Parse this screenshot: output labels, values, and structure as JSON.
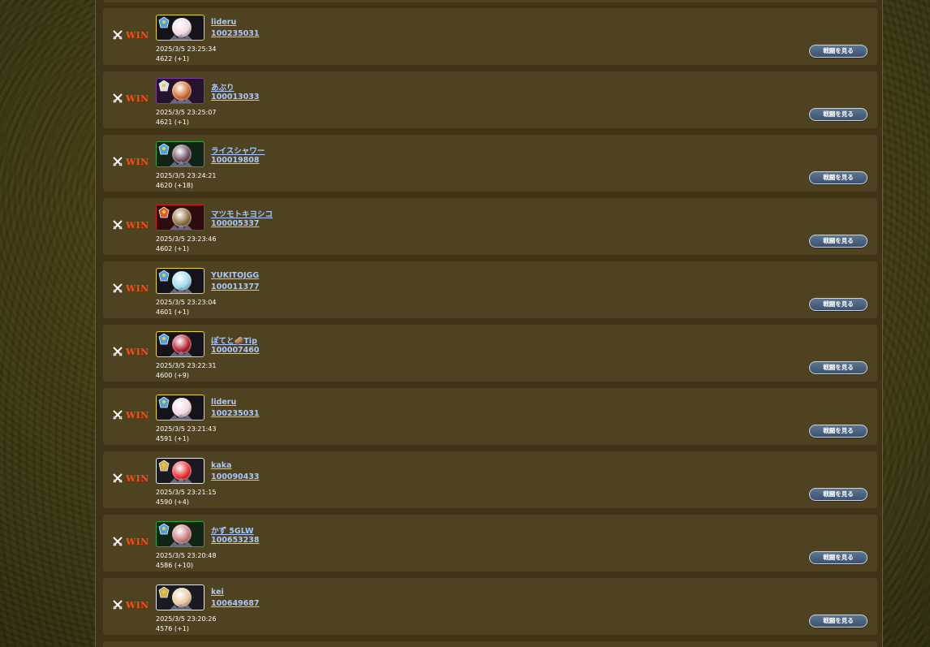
{
  "colors": {
    "win": "#ff4a12",
    "link": "#a8c8ff",
    "card": "#4e4220",
    "panel": "#403416",
    "button": "#4a6282"
  },
  "battles": [
    {
      "result": "WIN",
      "name": "lideru",
      "id": "100235031",
      "datetime": "2025/3/5 23:25:34",
      "rate": "4622 (+1)",
      "button": "戦闘を見る",
      "frame": "yellow",
      "avatar_color": "#f0d8e0",
      "badge": "blue-knight-icon"
    },
    {
      "result": "WIN",
      "name": "あぶり",
      "id": "100013033",
      "datetime": "2025/3/5 23:25:07",
      "rate": "4621 (+1)",
      "button": "戦闘を見る",
      "frame": "purple",
      "avatar_color": "#d06a2a",
      "badge": "skull-icon"
    },
    {
      "result": "WIN",
      "name": "ライスシャワー",
      "id": "100019808",
      "datetime": "2025/3/5 23:24:21",
      "rate": "4620 (+18)",
      "button": "戦闘を見る",
      "frame": "green",
      "avatar_color": "#6a4a5a",
      "badge": "blue-knight-icon"
    },
    {
      "result": "WIN",
      "name": "マツモトキヨシコ",
      "id": "100005337",
      "datetime": "2025/3/5 23:23:46",
      "rate": "4602 (+1)",
      "button": "戦闘を見る",
      "frame": "red",
      "avatar_color": "#8a6a3a",
      "badge": "dragon-icon"
    },
    {
      "result": "WIN",
      "name": "YUKITOJGG",
      "id": "100011377",
      "datetime": "2025/3/5 23:23:04",
      "rate": "4601 (+1)",
      "button": "戦闘を見る",
      "frame": "yellow",
      "avatar_color": "#9ad8ec",
      "badge": "blue-knight-icon"
    },
    {
      "result": "WIN",
      "name": "ぽてと🥔Tip",
      "id": "100007460",
      "datetime": "2025/3/5 23:22:31",
      "rate": "4600 (+9)",
      "button": "戦闘を見る",
      "frame": "yellow",
      "avatar_color": "#b01c2a",
      "badge": "blue-knight-icon"
    },
    {
      "result": "WIN",
      "name": "lideru",
      "id": "100235031",
      "datetime": "2025/3/5 23:21:43",
      "rate": "4591 (+1)",
      "button": "戦闘を見る",
      "frame": "yellow",
      "avatar_color": "#f0d8e0",
      "badge": "blue-knight-icon"
    },
    {
      "result": "WIN",
      "name": "kaka",
      "id": "100090433",
      "datetime": "2025/3/5 23:21:15",
      "rate": "4590 (+4)",
      "button": "戦闘を見る",
      "frame": "white",
      "avatar_color": "#e82a2a",
      "badge": "golden-beast-icon"
    },
    {
      "result": "WIN",
      "name": "かず 5GLW",
      "id": "100653238",
      "datetime": "2025/3/5 23:20:48",
      "rate": "4586 (+10)",
      "button": "戦闘を見る",
      "frame": "green",
      "avatar_color": "#c87a7a",
      "badge": "blue-knight-icon"
    },
    {
      "result": "WIN",
      "name": "kei",
      "id": "100649687",
      "datetime": "2025/3/5 23:20:26",
      "rate": "4576 (+1)",
      "button": "戦闘を見る",
      "frame": "white",
      "avatar_color": "#e8c89a",
      "badge": "golden-beast-icon"
    }
  ]
}
